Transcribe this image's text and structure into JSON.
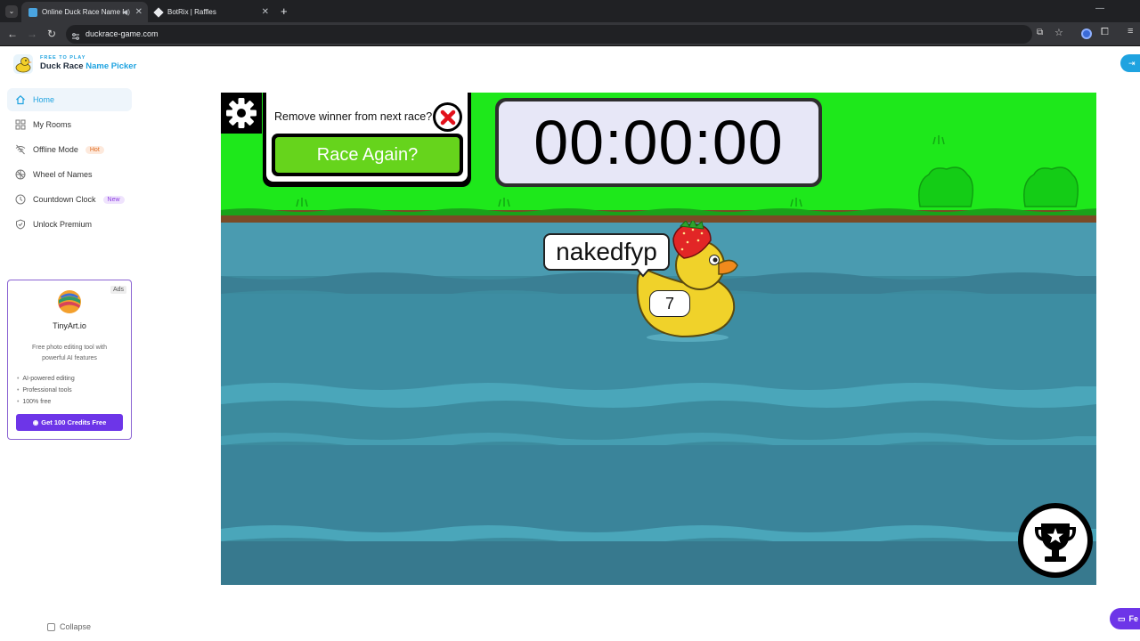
{
  "browser": {
    "tabs": [
      {
        "title": "Online Duck Race Name Pi",
        "active": true
      },
      {
        "title": "BotRix | Raffles",
        "active": false
      }
    ],
    "url": "duckrace-game.com"
  },
  "logo": {
    "tagline": "FREE TO PLAY",
    "title_main": "Duck Race",
    "title_accent": "Name Picker"
  },
  "sidebar": {
    "items": [
      {
        "label": "Home",
        "icon": "home-icon",
        "active": true,
        "badge": ""
      },
      {
        "label": "My Rooms",
        "icon": "grid-icon",
        "active": false,
        "badge": ""
      },
      {
        "label": "Offline Mode",
        "icon": "wifi-off-icon",
        "active": false,
        "badge": "Hot"
      },
      {
        "label": "Wheel of Names",
        "icon": "wheel-icon",
        "active": false,
        "badge": ""
      },
      {
        "label": "Countdown Clock",
        "icon": "clock-icon",
        "active": false,
        "badge": "New"
      },
      {
        "label": "Unlock Premium",
        "icon": "shield-icon",
        "active": false,
        "badge": ""
      }
    ],
    "collapse_label": "Collapse"
  },
  "ad": {
    "tag": "Ads",
    "name": "TinyArt.io",
    "description": "Free photo editing tool with powerful AI features",
    "features": [
      "AI-powered editing",
      "Professional tools",
      "100% free"
    ],
    "cta": "Get 100 Credits Free"
  },
  "game": {
    "remove_winner_label": "Remove winner from next race?",
    "race_again_label": "Race Again?",
    "timer": "00:00:00",
    "winner_name": "nakedfyp",
    "winner_number": "7"
  },
  "right_edge": {
    "feedback_label": "Fe"
  },
  "colors": {
    "grass": "#1ee81b",
    "water": "#3c8b9e",
    "race_again_button": "#66d41c",
    "accent": "#1fa3e0",
    "ad_cta": "#6d35e8"
  }
}
